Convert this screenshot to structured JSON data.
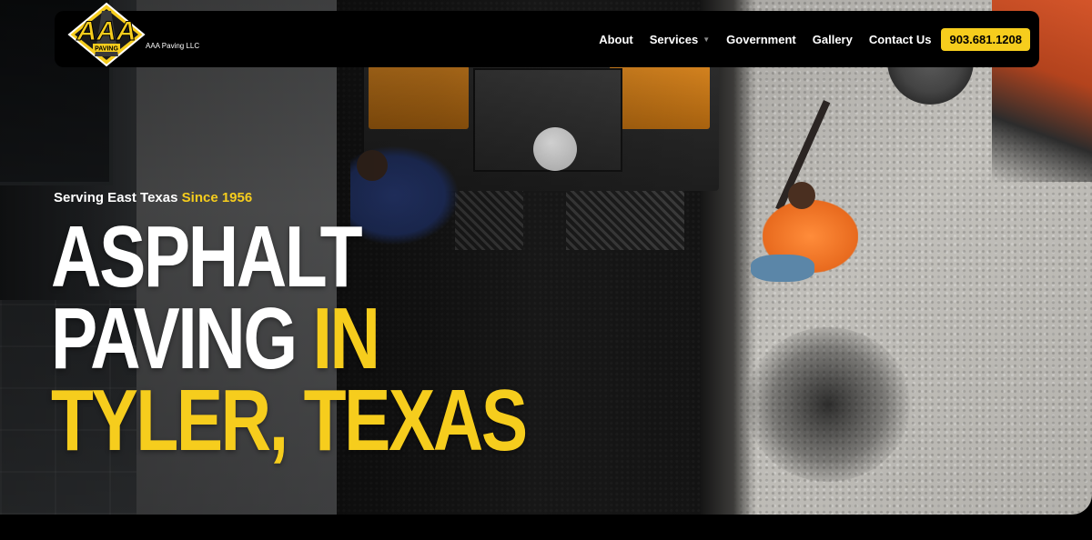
{
  "brand": {
    "logo_text": "AAA",
    "logo_tag": "PAVING",
    "company": "AAA Paving LLC",
    "colors": {
      "accent": "#f6cd1d",
      "nav_bg": "#000000",
      "text": "#ffffff"
    }
  },
  "nav": {
    "items": [
      {
        "label": "About"
      },
      {
        "label": "Services",
        "has_dropdown": true,
        "icon": "chevron-down-icon"
      },
      {
        "label": "Government"
      },
      {
        "label": "Gallery"
      },
      {
        "label": "Contact Us"
      }
    ],
    "phone": "903.681.1208"
  },
  "hero": {
    "eyebrow_prefix": "Serving East Texas",
    "eyebrow_highlight": "Since 1956",
    "headline_line1": "ASPHALT",
    "headline_line2_white": "PAVING",
    "headline_line2_yellow": "IN",
    "headline_line3": "TYLER, TEXAS",
    "background": "aerial photo of asphalt paving machine and worker"
  }
}
